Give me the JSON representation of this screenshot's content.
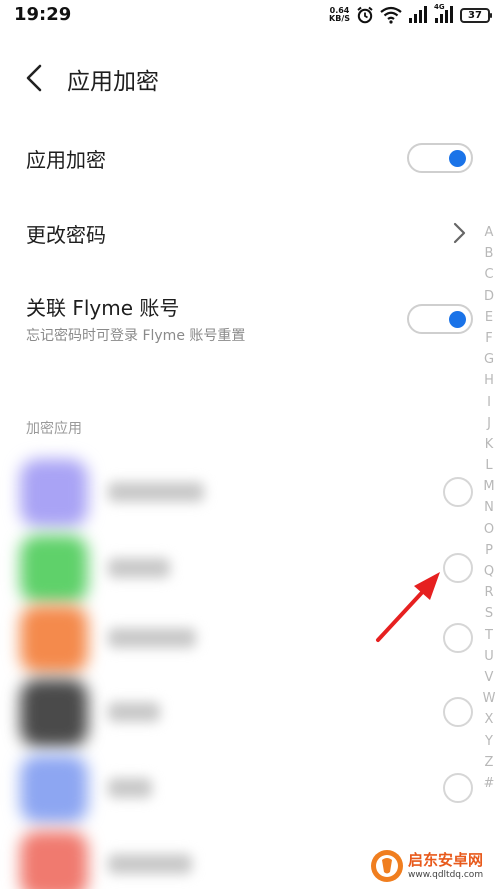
{
  "status_bar": {
    "time": "19:29",
    "net_speed_value": "0.64",
    "net_speed_unit": "KB/S",
    "lte_label": "4G",
    "battery": "37"
  },
  "header": {
    "title": "应用加密"
  },
  "settings": {
    "app_lock": {
      "label": "应用加密",
      "enabled": true
    },
    "change_password": {
      "label": "更改密码"
    },
    "link_flyme": {
      "label": "关联 Flyme 账号",
      "sublabel": "忘记密码时可登录 Flyme 账号重置",
      "enabled": true
    }
  },
  "section_header": "加密应用",
  "apps": [
    {
      "icon": "app-icon-purple",
      "color": "#a9a3f5",
      "checked": false
    },
    {
      "icon": "app-icon-green",
      "color": "#5fd16a",
      "checked": false
    },
    {
      "icon": "app-icon-orange",
      "color": "#f48a4c",
      "checked": false
    },
    {
      "icon": "app-icon-dark",
      "color": "#4a4a4a",
      "checked": false
    },
    {
      "icon": "app-icon-blue",
      "color": "#8da6f2",
      "checked": false
    },
    {
      "icon": "app-icon-red",
      "color": "#f07a6f",
      "checked": false
    }
  ],
  "alphabet_index": [
    "A",
    "B",
    "C",
    "D",
    "E",
    "F",
    "G",
    "H",
    "I",
    "J",
    "K",
    "L",
    "M",
    "N",
    "O",
    "P",
    "Q",
    "R",
    "S",
    "T",
    "U",
    "V",
    "W",
    "X",
    "Y",
    "Z",
    "#"
  ],
  "watermark": {
    "title": "启东安卓网",
    "url": "www.qdltdq.com"
  },
  "colors": {
    "accent": "#1a73e8",
    "arrow": "#e62020",
    "watermark_orange": "#e85a1c"
  }
}
